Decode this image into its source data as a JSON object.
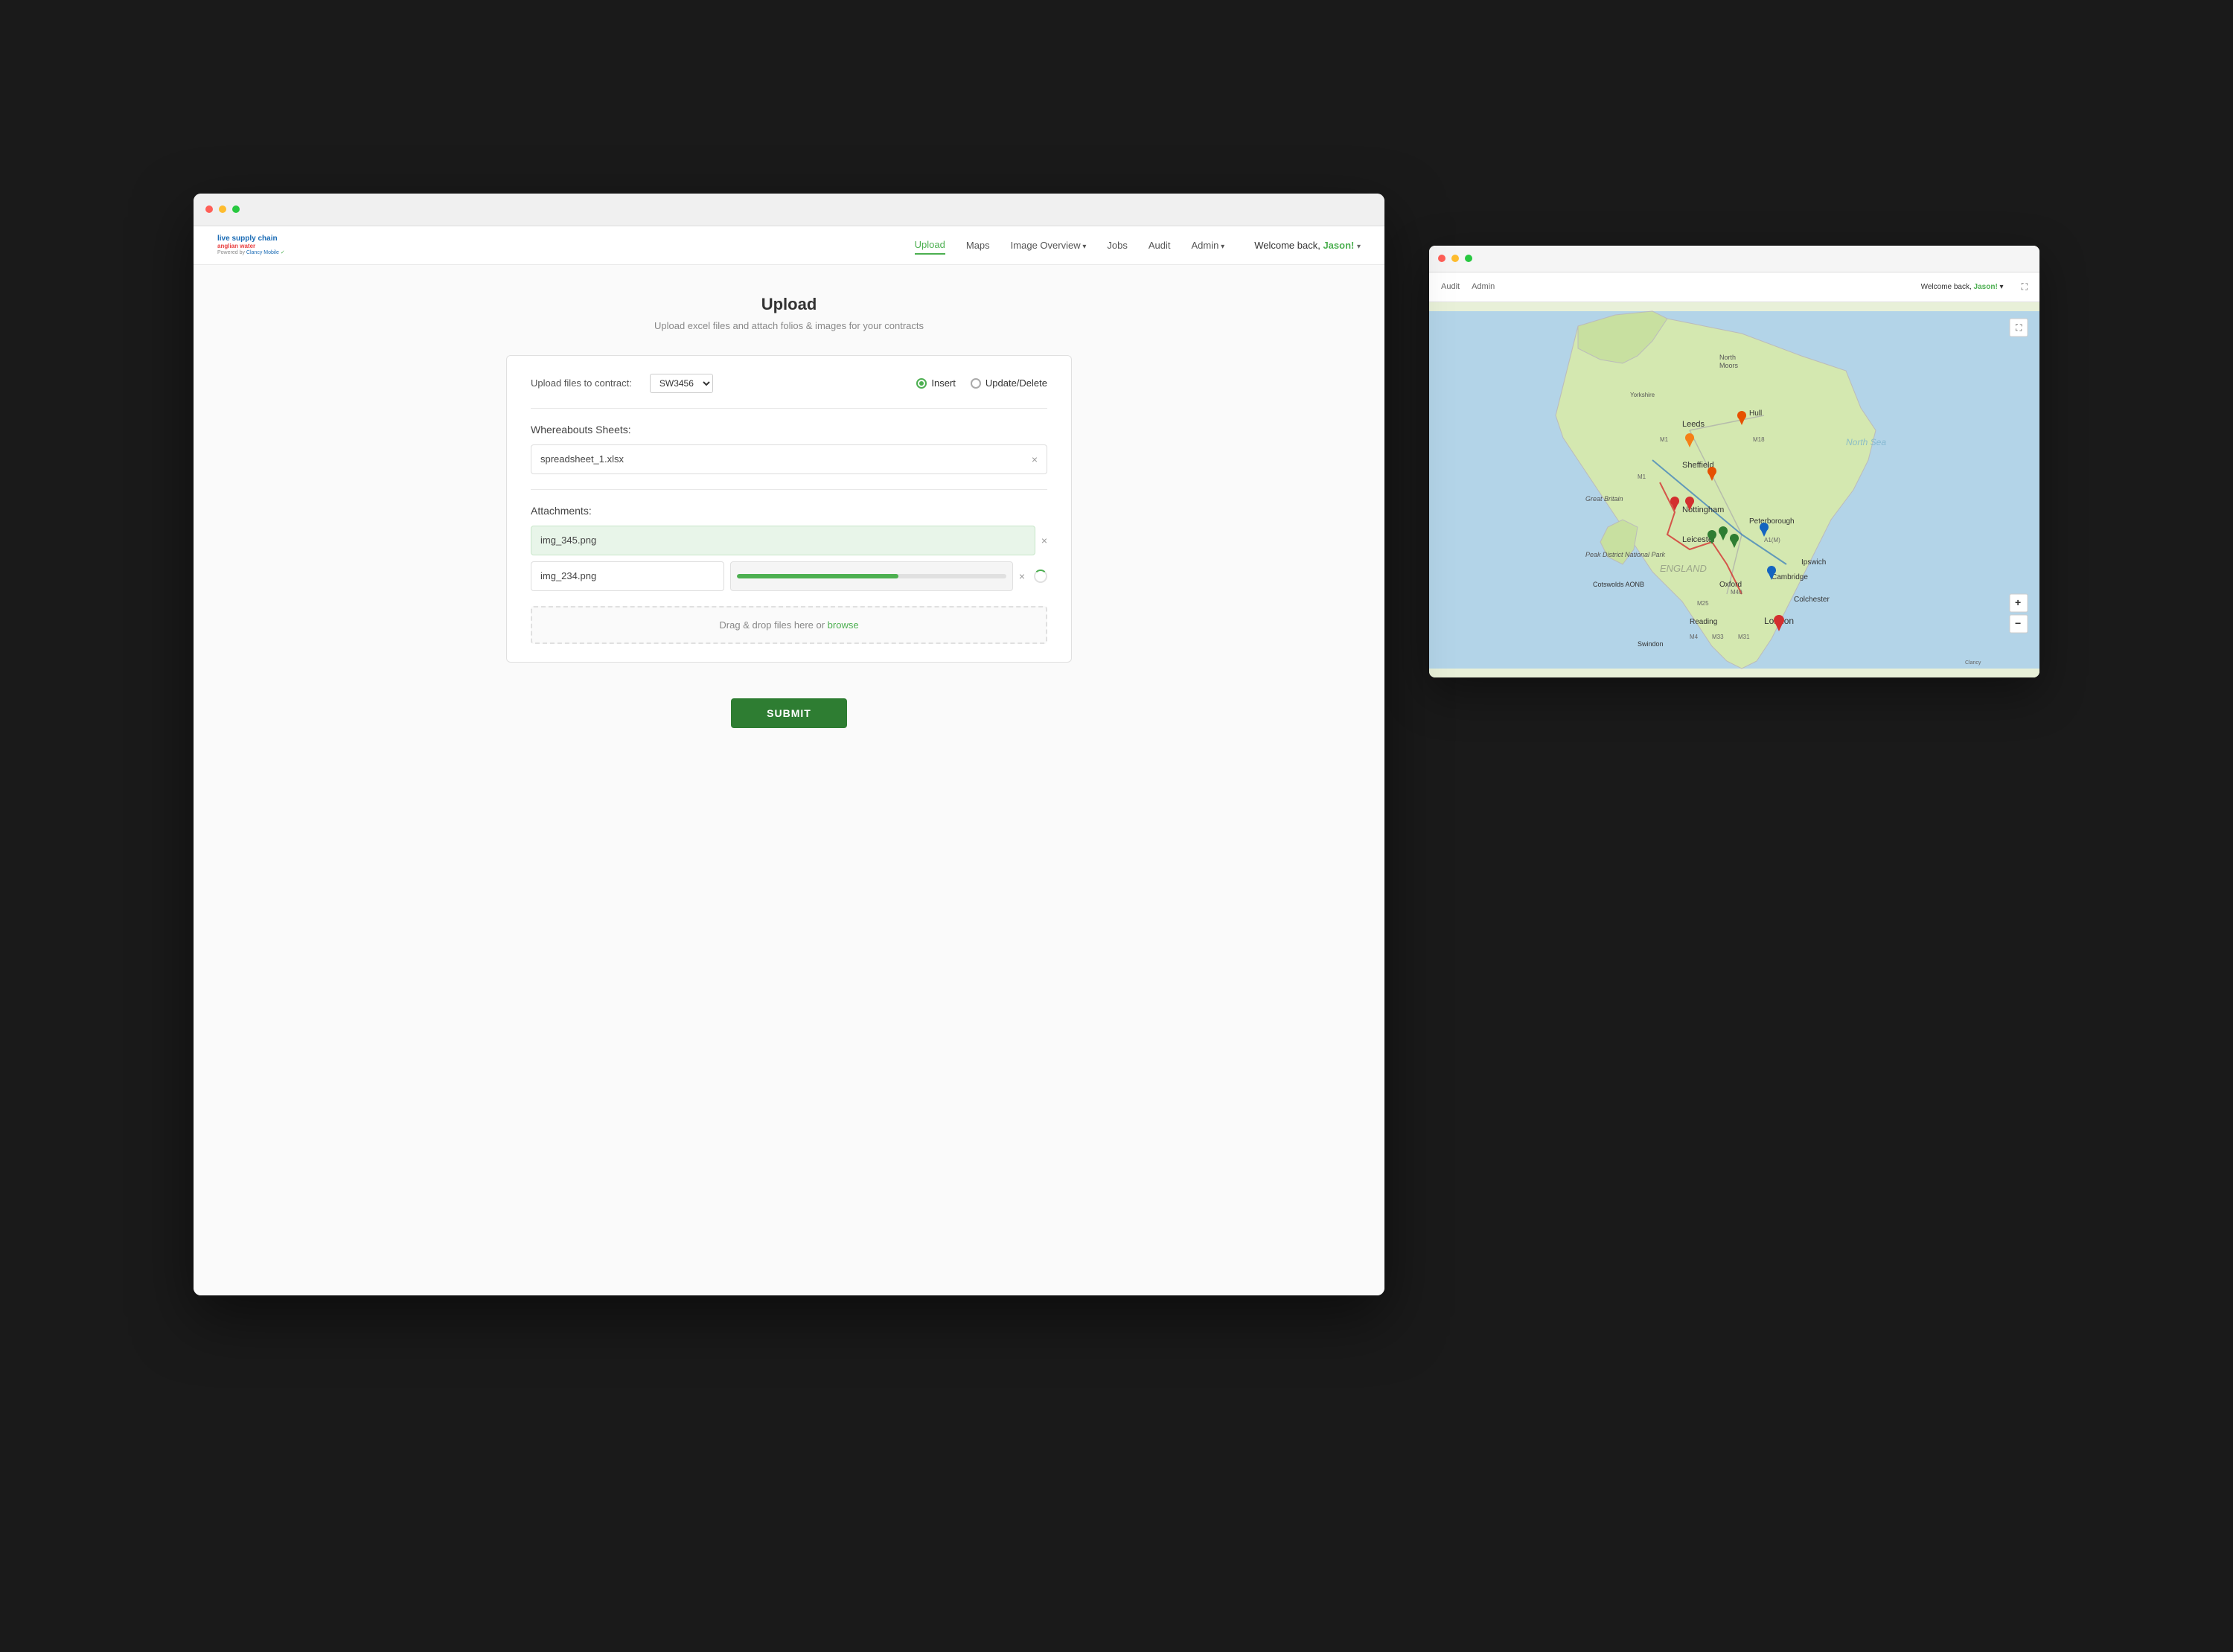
{
  "scene": {
    "browser": {
      "nav": {
        "logo_line1": "live supply chain",
        "logo_line2": "anglian water",
        "logo_powered": "Powered by Clancy Mobile",
        "links": [
          {
            "label": "Upload",
            "active": true
          },
          {
            "label": "Maps",
            "active": false
          },
          {
            "label": "Image Overview",
            "active": false,
            "has_arrow": true
          },
          {
            "label": "Jobs",
            "active": false
          },
          {
            "label": "Audit",
            "active": false
          },
          {
            "label": "Admin",
            "active": false,
            "has_arrow": true
          }
        ],
        "welcome_prefix": "Welcome back, ",
        "welcome_user": "Jason!",
        "welcome_arrow": "▾"
      },
      "page": {
        "title": "Upload",
        "subtitle": "Upload excel files and attach folios & images for your contracts",
        "contract_label": "Upload files to contract:",
        "contract_value": "SW3456",
        "radio_options": [
          {
            "label": "Insert",
            "selected": true
          },
          {
            "label": "Update/Delete",
            "selected": false
          }
        ],
        "whereabouts_label": "Whereabouts Sheets:",
        "whereabouts_file": "spreadsheet_1.xlsx",
        "attachments_label": "Attachments:",
        "attachments": [
          {
            "name": "img_345.png",
            "highlight": true,
            "progress": 100
          },
          {
            "name": "img_234.png",
            "highlight": false,
            "progress": 60
          }
        ],
        "drop_text": "Drag & drop files here or ",
        "browse_text": "browse",
        "submit_label": "SUBMIT"
      }
    },
    "map_window": {
      "mini_nav": {
        "audit_label": "Audit",
        "admin_label": "Admin",
        "welcome_prefix": "Welcome back, ",
        "welcome_user": "Jason!"
      }
    }
  }
}
